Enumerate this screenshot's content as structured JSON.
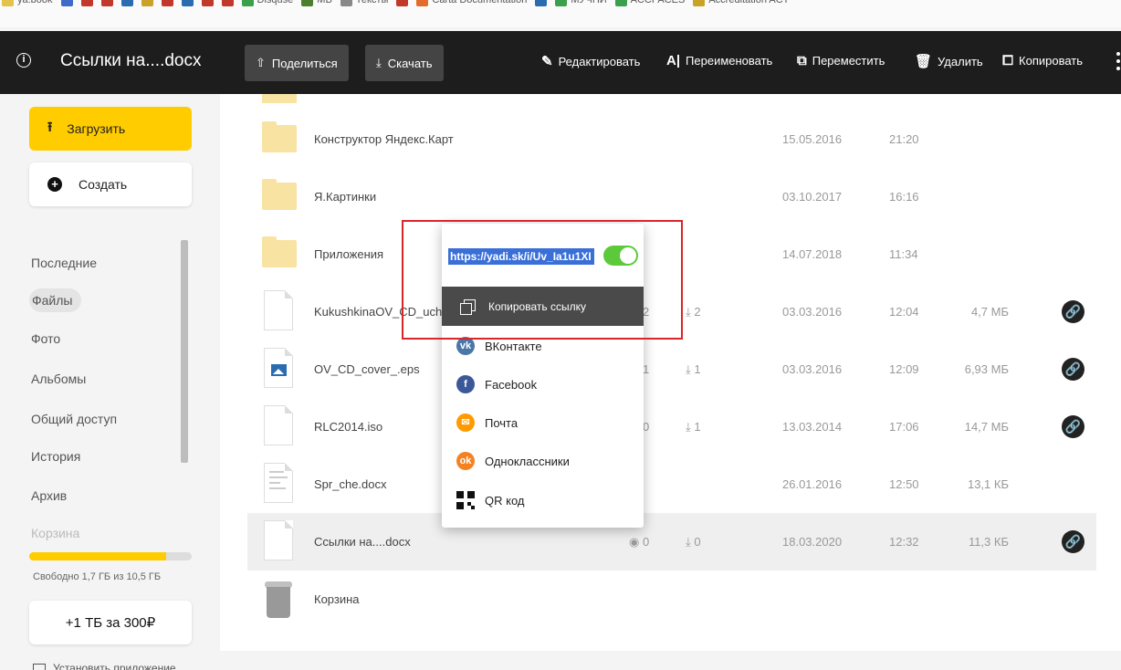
{
  "bookmarks": [
    {
      "label": "ya.book",
      "color": "#e3c34a"
    },
    {
      "label": "",
      "color": "#3c6bc8"
    },
    {
      "label": "",
      "color": "#c0392b"
    },
    {
      "label": "",
      "color": "#c0392b"
    },
    {
      "label": "",
      "color": "#2b6cb0"
    },
    {
      "label": "",
      "color": "#c9a227"
    },
    {
      "label": "",
      "color": "#c0392b"
    },
    {
      "label": "",
      "color": "#2b6cb0"
    },
    {
      "label": "",
      "color": "#c0392b"
    },
    {
      "label": "",
      "color": "#c0392b"
    },
    {
      "label": "Disquse",
      "color": "#3aa04c"
    },
    {
      "label": "MB",
      "color": "#4a7f2e"
    },
    {
      "label": "Тексты",
      "color": "#888888"
    },
    {
      "label": "",
      "color": "#c0392b"
    },
    {
      "label": "Carta Documentation",
      "color": "#e36c2b"
    },
    {
      "label": "",
      "color": "#2b6cb0"
    },
    {
      "label": "МУЧПИ",
      "color": "#3aa04c"
    },
    {
      "label": "ACCPACES",
      "color": "#3aa04c"
    },
    {
      "label": "Accreditation ACT",
      "color": "#c9a227"
    }
  ],
  "toolbar": {
    "title": "Ссылки на....docx",
    "share": "Поделиться",
    "download": "Скачать",
    "edit": "Редактировать",
    "rename": "Переименовать",
    "move": "Переместить",
    "delete": "Удалить",
    "copy": "Копировать"
  },
  "sidebar": {
    "upload": "Загрузить",
    "create": "Создать",
    "nav": [
      "Последние",
      "Файлы",
      "Фото",
      "Альбомы",
      "Общий доступ",
      "История",
      "Архив",
      "Корзина"
    ],
    "active": "Файлы",
    "storage_text": "Свободно 1,7 ГБ из 10,5 ГБ",
    "storage_used_fraction": 0.84,
    "promo": "+1 ТБ за 300₽",
    "install": "Установить приложение"
  },
  "files": [
    {
      "name": "Конструктор Яндекс.Карт",
      "type": "folder",
      "views": "",
      "downloads": "",
      "date": "15.05.2016",
      "time": "21:20",
      "size": "",
      "shared": false
    },
    {
      "name": "Я.Картинки",
      "type": "folder",
      "views": "",
      "downloads": "",
      "date": "03.10.2017",
      "time": "16:16",
      "size": "",
      "shared": false
    },
    {
      "name": "Приложения",
      "type": "folder",
      "views": "",
      "downloads": "",
      "date": "14.07.2018",
      "time": "11:34",
      "size": "",
      "shared": false
    },
    {
      "name": "KukushkinaOV_CD_uchebnik...",
      "type": "file",
      "views": "2",
      "downloads": "2",
      "date": "03.03.2016",
      "time": "12:04",
      "size": "4,7 МБ",
      "shared": true
    },
    {
      "name": "OV_CD_cover_.eps",
      "type": "image",
      "views": "1",
      "downloads": "1",
      "date": "03.03.2016",
      "time": "12:09",
      "size": "6,93 МБ",
      "shared": true
    },
    {
      "name": "RLC2014.iso",
      "type": "file",
      "views": "0",
      "downloads": "1",
      "date": "13.03.2014",
      "time": "17:06",
      "size": "14,7 МБ",
      "shared": true
    },
    {
      "name": "Spr_che.docx",
      "type": "doc",
      "views": "",
      "downloads": "",
      "date": "26.01.2016",
      "time": "12:50",
      "size": "13,1 КБ",
      "shared": false
    },
    {
      "name": "Ссылки на....docx",
      "type": "file",
      "views": "0",
      "downloads": "0",
      "date": "18.03.2020",
      "time": "12:32",
      "size": "11,3 КБ",
      "shared": true,
      "selected": true
    },
    {
      "name": "Корзина",
      "type": "trash",
      "views": "",
      "downloads": "",
      "date": "",
      "time": "",
      "size": "",
      "shared": false
    }
  ],
  "share_popup": {
    "url": "https://yadi.sk/i/Uv_Ia1u1XI",
    "toggle_on": true,
    "copy_link": "Копировать ссылку",
    "targets": [
      {
        "label": "ВКонтакте",
        "icon": "vk-icon",
        "color": "#4a76a8",
        "glyph": "vk"
      },
      {
        "label": "Facebook",
        "icon": "facebook-icon",
        "color": "#3b5998",
        "glyph": "f"
      },
      {
        "label": "Почта",
        "icon": "mail-icon",
        "color": "#ff9a00",
        "glyph": "✉"
      },
      {
        "label": "Одноклассники",
        "icon": "odnoklassniki-icon",
        "color": "#f58220",
        "glyph": "ok"
      },
      {
        "label": "QR код",
        "icon": "qr-code-icon",
        "color": "#111111",
        "glyph": ""
      }
    ]
  },
  "colors": {
    "accent": "#ffcc00",
    "toolbar_bg": "#1d1d1d",
    "highlight": "#d9262b",
    "toggle": "#5cc93a"
  }
}
